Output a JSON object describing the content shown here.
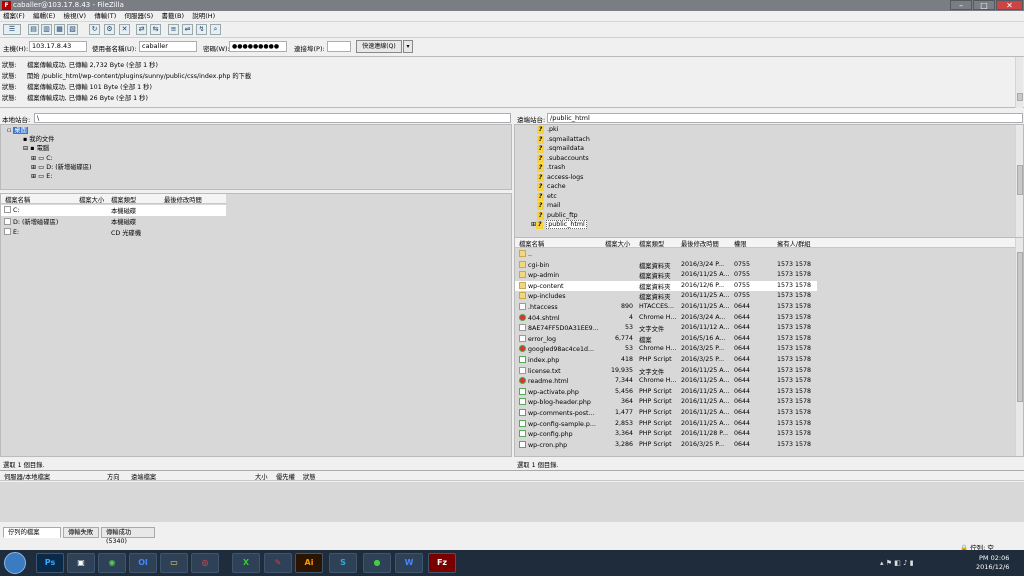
{
  "window": {
    "title": "caballer@103.17.8.43 - FileZilla"
  },
  "menu": [
    "檔案(F)",
    "編輯(E)",
    "檢視(V)",
    "傳輸(T)",
    "伺服器(S)",
    "書籤(B)",
    "說明(H)"
  ],
  "quickconnect": {
    "host_label": "主機(H):",
    "host_value": "103.17.8.43",
    "user_label": "使用者名稱(U):",
    "user_value": "caballer",
    "pass_label": "密碼(W):",
    "pass_value": "●●●●●●●●●",
    "port_label": "連接埠(P):",
    "port_value": "",
    "button": "快速連線(Q)"
  },
  "log": [
    {
      "k": "狀態:",
      "v": "檔案傳輸成功, 已傳輸 2,732 Byte (全部 1 秒)"
    },
    {
      "k": "狀態:",
      "v": "開始 /public_html/wp-content/plugins/sunny/public/css/index.php 的下載"
    },
    {
      "k": "狀態:",
      "v": "檔案傳輸成功, 已傳輸 101 Byte (全部 1 秒)"
    },
    {
      "k": "狀態:",
      "v": "檔案傳輸成功, 已傳輸 26 Byte (全部 1 秒)"
    }
  ],
  "local": {
    "site_label": "本地站台:",
    "site_value": "\\",
    "tree": [
      "桌面",
      "我的文件",
      "電腦",
      "C:",
      "D: (新增磁碟區)",
      "E:"
    ],
    "headers": {
      "name": "檔案名稱",
      "size": "檔案大小",
      "type": "檔案類型",
      "modified": "最後修改時間"
    },
    "rows": [
      {
        "name": "C:",
        "type": "本機磁碟"
      },
      {
        "name": "D: (新增磁碟區)",
        "type": "本機磁碟"
      },
      {
        "name": "E:",
        "type": "CD 光碟機"
      }
    ],
    "status": "選取 1 個目錄."
  },
  "remote": {
    "site_label": "遠端站台:",
    "site_value": "/public_html",
    "tree": [
      ".pki",
      ".sqmailattach",
      ".sqmaildata",
      ".subaccounts",
      ".trash",
      "access-logs",
      "cache",
      "etc",
      "mail",
      "public_ftp",
      "public_html"
    ],
    "headers": {
      "name": "檔案名稱",
      "size": "檔案大小",
      "type": "檔案類型",
      "modified": "最後修改時間",
      "perm": "權限",
      "owner": "擁有人/群組"
    },
    "rows": [
      {
        "name": "..",
        "size": "",
        "type": "",
        "modified": "",
        "perm": "",
        "owner": "",
        "icon": "folder"
      },
      {
        "name": "cgi-bin",
        "size": "",
        "type": "檔案資料夾",
        "modified": "2016/3/24 P...",
        "perm": "0755",
        "owner": "1573 1578",
        "icon": "folder"
      },
      {
        "name": "wp-admin",
        "size": "",
        "type": "檔案資料夾",
        "modified": "2016/11/25 A...",
        "perm": "0755",
        "owner": "1573 1578",
        "icon": "folder"
      },
      {
        "name": "wp-content",
        "size": "",
        "type": "檔案資料夾",
        "modified": "2016/12/6 P...",
        "perm": "0755",
        "owner": "1573 1578",
        "icon": "folder"
      },
      {
        "name": "wp-includes",
        "size": "",
        "type": "檔案資料夾",
        "modified": "2016/11/25 A...",
        "perm": "0755",
        "owner": "1573 1578",
        "icon": "folder"
      },
      {
        "name": ".htaccess",
        "size": "890",
        "type": "HTACCES...",
        "modified": "2016/11/25 A...",
        "perm": "0644",
        "owner": "1573 1578",
        "icon": "file"
      },
      {
        "name": "404.shtml",
        "size": "4",
        "type": "Chrome H...",
        "modified": "2016/3/24 A...",
        "perm": "0644",
        "owner": "1573 1578",
        "icon": "chrome"
      },
      {
        "name": "8AE74FF5D0A31EE9...",
        "size": "53",
        "type": "文字文件",
        "modified": "2016/11/12 A...",
        "perm": "0644",
        "owner": "1573 1578",
        "icon": "file"
      },
      {
        "name": "error_log",
        "size": "6,774",
        "type": "檔案",
        "modified": "2016/5/16 A...",
        "perm": "0644",
        "owner": "1573 1578",
        "icon": "file"
      },
      {
        "name": "googled98ac4ce1d...",
        "size": "53",
        "type": "Chrome H...",
        "modified": "2016/3/25 P...",
        "perm": "0644",
        "owner": "1573 1578",
        "icon": "chrome"
      },
      {
        "name": "index.php",
        "size": "418",
        "type": "PHP Script",
        "modified": "2016/3/25 P...",
        "perm": "0644",
        "owner": "1573 1578",
        "icon": "php"
      },
      {
        "name": "license.txt",
        "size": "19,935",
        "type": "文字文件",
        "modified": "2016/11/25 A...",
        "perm": "0644",
        "owner": "1573 1578",
        "icon": "file"
      },
      {
        "name": "readme.html",
        "size": "7,344",
        "type": "Chrome H...",
        "modified": "2016/11/25 A...",
        "perm": "0644",
        "owner": "1573 1578",
        "icon": "chrome"
      },
      {
        "name": "wp-activate.php",
        "size": "5,456",
        "type": "PHP Script",
        "modified": "2016/11/25 A...",
        "perm": "0644",
        "owner": "1573 1578",
        "icon": "php"
      },
      {
        "name": "wp-blog-header.php",
        "size": "364",
        "type": "PHP Script",
        "modified": "2016/11/25 A...",
        "perm": "0644",
        "owner": "1573 1578",
        "icon": "php"
      },
      {
        "name": "wp-comments-post...",
        "size": "1,477",
        "type": "PHP Script",
        "modified": "2016/11/25 A...",
        "perm": "0644",
        "owner": "1573 1578",
        "icon": "php"
      },
      {
        "name": "wp-config-sample.p...",
        "size": "2,853",
        "type": "PHP Script",
        "modified": "2016/11/25 A...",
        "perm": "0644",
        "owner": "1573 1578",
        "icon": "php"
      },
      {
        "name": "wp-config.php",
        "size": "3,364",
        "type": "PHP Script",
        "modified": "2016/11/28 P...",
        "perm": "0644",
        "owner": "1573 1578",
        "icon": "php"
      },
      {
        "name": "wp-cron.php",
        "size": "3,286",
        "type": "PHP Script",
        "modified": "2016/3/25 P...",
        "perm": "0644",
        "owner": "1573 1578",
        "icon": "php"
      }
    ],
    "status": "選取 1 個目錄."
  },
  "queue": {
    "headers": {
      "file": "伺服器/本地檔案",
      "dir": "方向",
      "remote": "遠端檔案",
      "size": "大小",
      "prio": "優先權",
      "status": "狀態"
    },
    "tabs": [
      "佇列的檔案",
      "傳輸失敗",
      "傳輸成功 (5340)"
    ],
    "queue_status": "佇列: 空"
  },
  "taskbar": {
    "apps": [
      "Ps",
      "",
      "",
      "Ol",
      "",
      "",
      "X",
      "",
      "Ai",
      "S",
      "",
      "W",
      "Fz"
    ],
    "time": "PM 02:06",
    "date": "2016/12/6"
  }
}
